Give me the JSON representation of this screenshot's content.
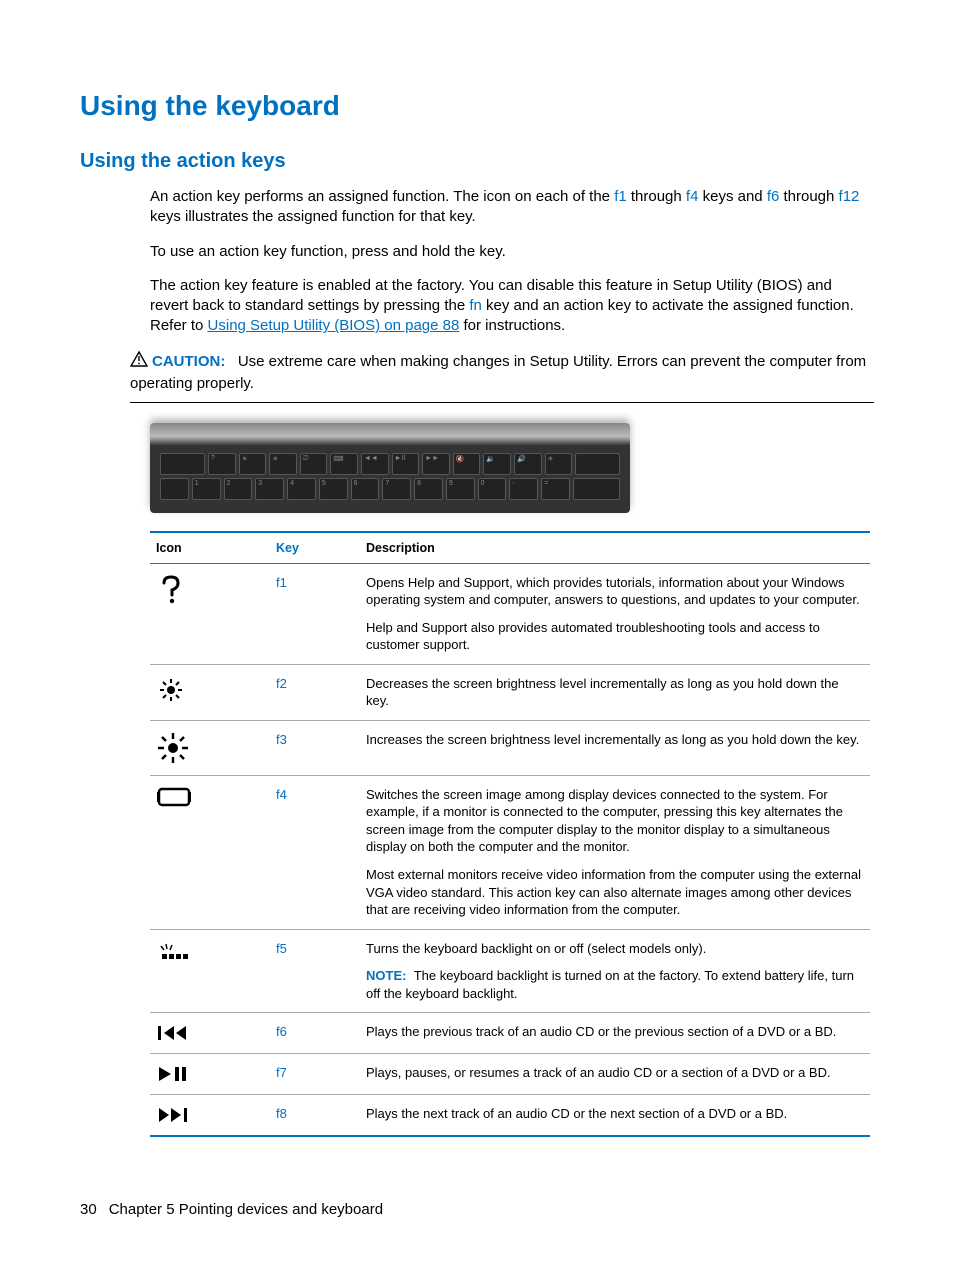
{
  "heading1": "Using the keyboard",
  "heading2": "Using the action keys",
  "para1_a": "An action key performs an assigned function. The icon on each of the ",
  "para1_f1": "f1",
  "para1_b": " through ",
  "para1_f4": "f4",
  "para1_c": " keys and ",
  "para1_f6": "f6",
  "para1_d": " through ",
  "para1_f12": "f12",
  "para1_e": " keys illustrates the assigned function for that key.",
  "para2": "To use an action key function, press and hold the key.",
  "para3_a": "The action key feature is enabled at the factory. You can disable this feature in Setup Utility (BIOS) and revert back to standard settings by pressing the ",
  "para3_fn": "fn",
  "para3_b": " key and an action key to activate the assigned function. Refer to ",
  "para3_link": "Using Setup Utility (BIOS) on page 88",
  "para3_c": " for instructions.",
  "caution_label": "CAUTION:",
  "caution_text": "Use extreme care when making changes in Setup Utility. Errors can prevent the computer from operating properly.",
  "table": {
    "headers": {
      "icon": "Icon",
      "key": "Key",
      "desc": "Description"
    },
    "rows": [
      {
        "icon": "help-icon",
        "key": "f1",
        "desc": [
          "Opens Help and Support, which provides tutorials, information about your Windows operating system and computer, answers to questions, and updates to your computer.",
          "Help and Support also provides automated troubleshooting tools and access to customer support."
        ]
      },
      {
        "icon": "brightness-down-icon",
        "key": "f2",
        "desc": [
          "Decreases the screen brightness level incrementally as long as you hold down the key."
        ]
      },
      {
        "icon": "brightness-up-icon",
        "key": "f3",
        "desc": [
          "Increases the screen brightness level incrementally as long as you hold down the key."
        ]
      },
      {
        "icon": "display-switch-icon",
        "key": "f4",
        "desc": [
          "Switches the screen image among display devices connected to the system. For example, if a monitor is connected to the computer, pressing this key alternates the screen image from the computer display to the monitor display to a simultaneous display on both the computer and the monitor.",
          "Most external monitors receive video information from the computer using the external VGA video standard. This action key can also alternate images among other devices that are receiving video information from the computer."
        ]
      },
      {
        "icon": "backlight-icon",
        "key": "f5",
        "desc": [
          "Turns the keyboard backlight on or off (select models only)."
        ],
        "note_label": "NOTE:",
        "note_text": "The keyboard backlight is turned on at the factory. To extend battery life, turn off the keyboard backlight."
      },
      {
        "icon": "prev-track-icon",
        "key": "f6",
        "desc": [
          "Plays the previous track of an audio CD or the previous section of a DVD or a BD."
        ]
      },
      {
        "icon": "play-pause-icon",
        "key": "f7",
        "desc": [
          "Plays, pauses, or resumes a track of an audio CD or a section of a DVD or a BD."
        ]
      },
      {
        "icon": "next-track-icon",
        "key": "f8",
        "desc": [
          "Plays the next track of an audio CD or the next section of a DVD or a BD."
        ]
      }
    ]
  },
  "footer": {
    "page": "30",
    "chapter": "Chapter 5   Pointing devices and keyboard"
  }
}
